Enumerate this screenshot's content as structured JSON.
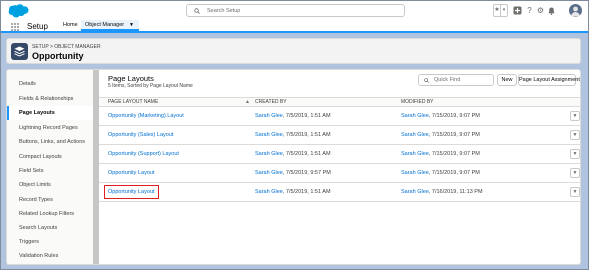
{
  "header": {
    "search_placeholder": "Search Setup",
    "icons": [
      "star-icon",
      "chevron-down-icon",
      "add-icon",
      "help-icon",
      "gear-icon",
      "bell-icon",
      "avatar"
    ]
  },
  "nav": {
    "app_name": "Setup",
    "tabs": [
      {
        "label": "Home"
      },
      {
        "label": "Object Manager",
        "active": true
      }
    ]
  },
  "page_header": {
    "breadcrumb": "SETUP > OBJECT MANAGER",
    "title": "Opportunity"
  },
  "sidebar": {
    "items": [
      {
        "label": "Details"
      },
      {
        "label": "Fields & Relationships"
      },
      {
        "label": "Page Layouts",
        "active": true
      },
      {
        "label": "Lightning Record Pages"
      },
      {
        "label": "Buttons, Links, and Actions"
      },
      {
        "label": "Compact Layouts"
      },
      {
        "label": "Field Sets"
      },
      {
        "label": "Object Limits"
      },
      {
        "label": "Record Types"
      },
      {
        "label": "Related Lookup Filters"
      },
      {
        "label": "Search Layouts"
      },
      {
        "label": "Triggers"
      },
      {
        "label": "Validation Rules"
      }
    ]
  },
  "content": {
    "title": "Page Layouts",
    "subtitle": "5 Items, Sorted by Page Layout Name",
    "quick_find_placeholder": "Quick Find",
    "new_label": "New",
    "assignment_label": "Page Layout Assignment",
    "columns": {
      "name": "PAGE LAYOUT NAME",
      "created": "CREATED BY",
      "modified": "MODIFIED BY"
    },
    "rows": [
      {
        "name": "Opportunity (Marketing) Layout",
        "created_by": "Sarah Glee",
        "created_at": ", 7/5/2019, 1:51 AM",
        "modified_by": "Sarah Glee",
        "modified_at": ", 7/15/2019, 9:07 PM"
      },
      {
        "name": "Opportunity (Sales) Layout",
        "created_by": "Sarah Glee",
        "created_at": ", 7/5/2019, 1:51 AM",
        "modified_by": "Sarah Glee",
        "modified_at": ", 7/15/2019, 9:07 PM"
      },
      {
        "name": "Opportunity (Support) Layout",
        "created_by": "Sarah Glee",
        "created_at": ", 7/5/2019, 1:51 AM",
        "modified_by": "Sarah Glee",
        "modified_at": ", 7/15/2019, 9:07 PM"
      },
      {
        "name": "Opportunity Layout",
        "created_by": "Sarah Glee",
        "created_at": ", 7/5/2019, 9:57 PM",
        "modified_by": "Sarah Glee",
        "modified_at": ", 7/15/2019, 9:07 PM"
      },
      {
        "name": "Opportunity Layout",
        "created_by": "Sarah Glee",
        "created_at": ", 7/5/2019, 1:51 AM",
        "modified_by": "Sarah Glee",
        "modified_at": ", 7/16/2019, 11:13 PM",
        "highlighted": true
      }
    ]
  },
  "colors": {
    "accent": "#1b96ff",
    "link": "#0070d2",
    "highlight_box": "#e02020"
  }
}
